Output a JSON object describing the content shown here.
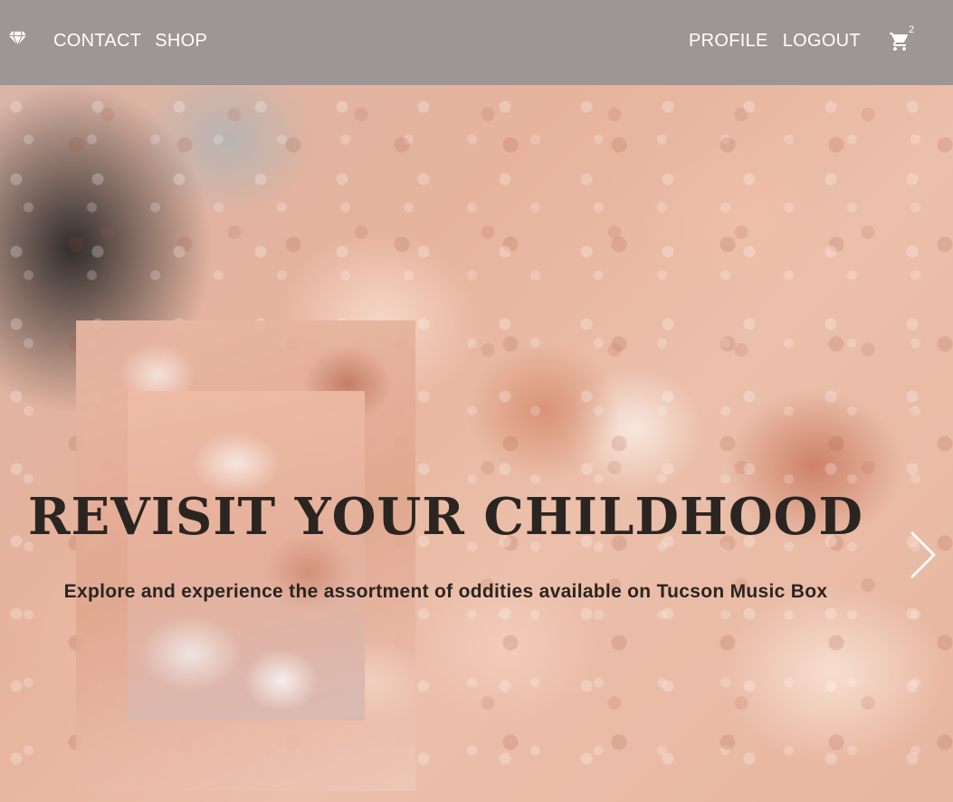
{
  "navbar": {
    "logo_icon": "diamond-icon",
    "links_left": [
      "CONTACT",
      "SHOP"
    ],
    "links_right": [
      "PROFILE",
      "LOGOUT"
    ],
    "cart": {
      "icon": "cart-icon",
      "count": "2"
    },
    "background": "#9e9596"
  },
  "hero": {
    "title": "REVISIT YOUR CHILDHOOD",
    "subtitle": "Explore and experience the assortment of oddities available on Tucson Music Box",
    "next_icon": "chevron-right-icon",
    "text_color": "#2b2521"
  }
}
